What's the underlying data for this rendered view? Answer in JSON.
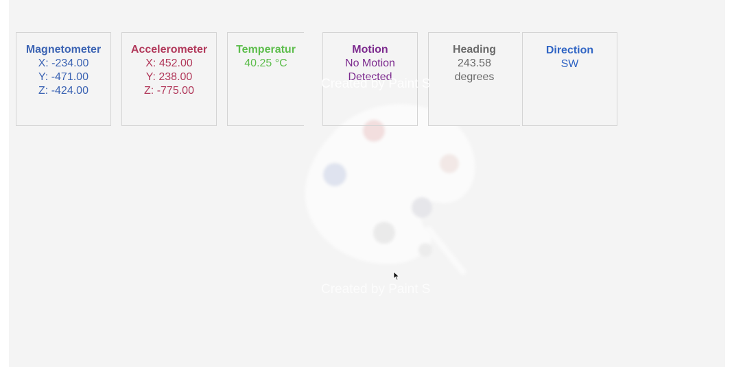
{
  "cards": {
    "magnetometer": {
      "title": "Magnetometer",
      "x": "X: -234.00",
      "y": "Y: -471.00",
      "z": "Z: -424.00"
    },
    "accelerometer": {
      "title": "Accelerometer",
      "x": "X: 452.00",
      "y": "Y: 238.00",
      "z": "Z: -775.00"
    },
    "temperature": {
      "title": "Temperatur",
      "value": "40.25 °C"
    },
    "motion": {
      "title": "Motion",
      "line1": "No Motion",
      "line2": "Detected"
    },
    "heading": {
      "title": "Heading",
      "value": "243.58",
      "unit": "degrees"
    },
    "direction": {
      "title": "Direction",
      "value": "SW"
    }
  },
  "watermark": {
    "top_text": "Created by Paint S",
    "bottom_text": "Created by Paint S",
    "icon": "palette-icon"
  },
  "colors": {
    "magnetometer": "#3b63b3",
    "accelerometer": "#b1385a",
    "temperature": "#5cbd4b",
    "motion": "#7c2a8e",
    "heading": "#6a6a6a",
    "direction": "#2f64c4"
  }
}
